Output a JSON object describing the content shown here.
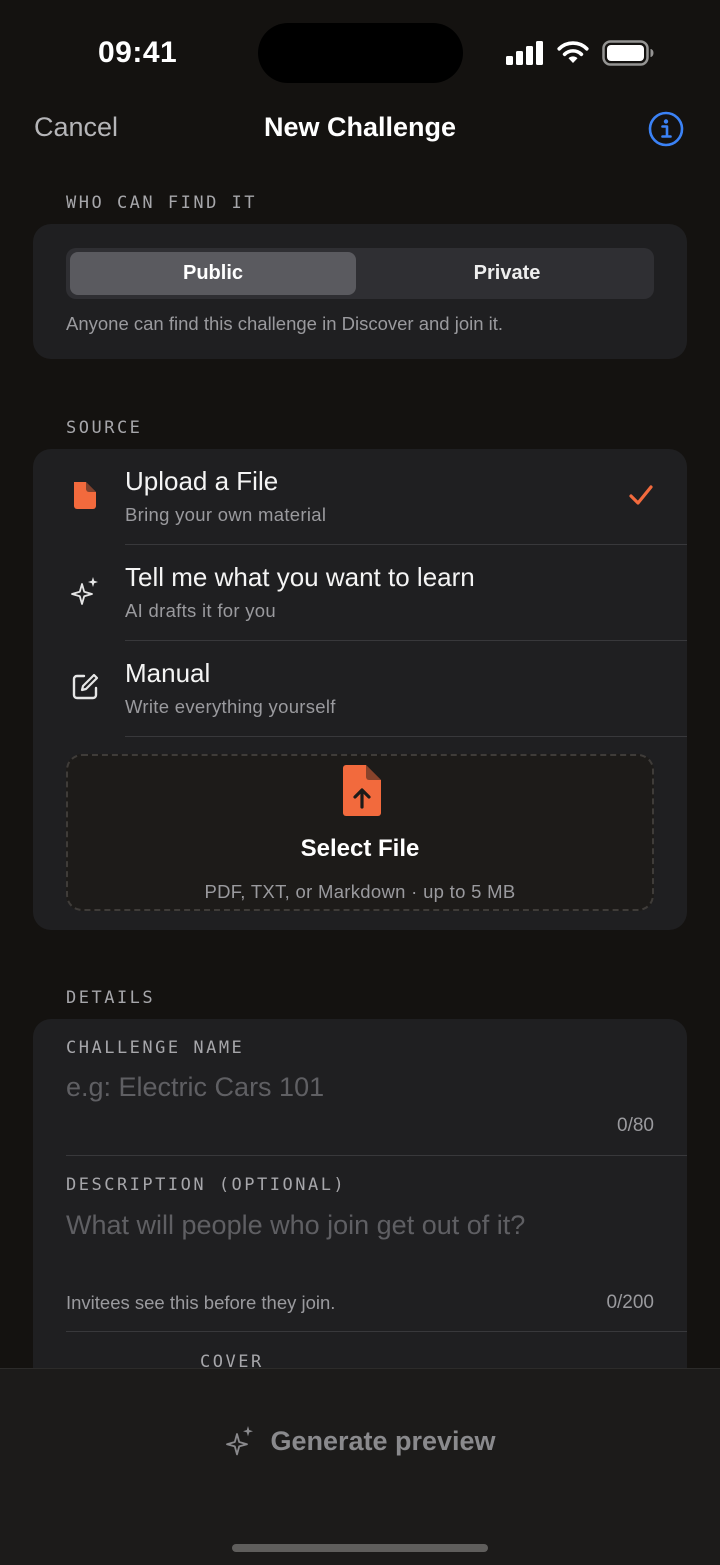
{
  "status_bar": {
    "time": "09:41"
  },
  "nav": {
    "cancel": "Cancel",
    "title": "New Challenge",
    "info_icon": "info-circle-icon"
  },
  "visibility": {
    "section_label": "WHO CAN FIND IT",
    "options": [
      "Public",
      "Private"
    ],
    "selected": "Public",
    "hint": "Anyone can find this challenge in Discover and join it."
  },
  "source": {
    "section_label": "SOURCE",
    "options": [
      {
        "title": "Upload a File",
        "subtitle": "Bring your own material",
        "icon": "document-icon",
        "selected": true
      },
      {
        "title": "Tell me what you want to learn",
        "subtitle": "AI drafts it for you",
        "icon": "sparkles-icon",
        "selected": false
      },
      {
        "title": "Manual",
        "subtitle": "Write everything yourself",
        "icon": "edit-icon",
        "selected": false
      }
    ],
    "dropzone": {
      "title": "Select File",
      "subtitle": "PDF, TXT, or Markdown · up to 5 MB"
    }
  },
  "details": {
    "section_label": "DETAILS",
    "name": {
      "label": "CHALLENGE NAME",
      "placeholder": "e.g: Electric Cars 101",
      "value": "",
      "counter": "0/80"
    },
    "description": {
      "label": "DESCRIPTION (OPTIONAL)",
      "placeholder": "What will people who join get out of it?",
      "value": "",
      "hint": "Invitees see this before they join.",
      "counter": "0/200"
    },
    "cover_label": "COVER"
  },
  "footer": {
    "generate_label": "Generate preview"
  },
  "colors": {
    "accent": "#f26a3d",
    "info_blue": "#3b82f6",
    "background": "#141210",
    "card": "#1f1f21"
  }
}
